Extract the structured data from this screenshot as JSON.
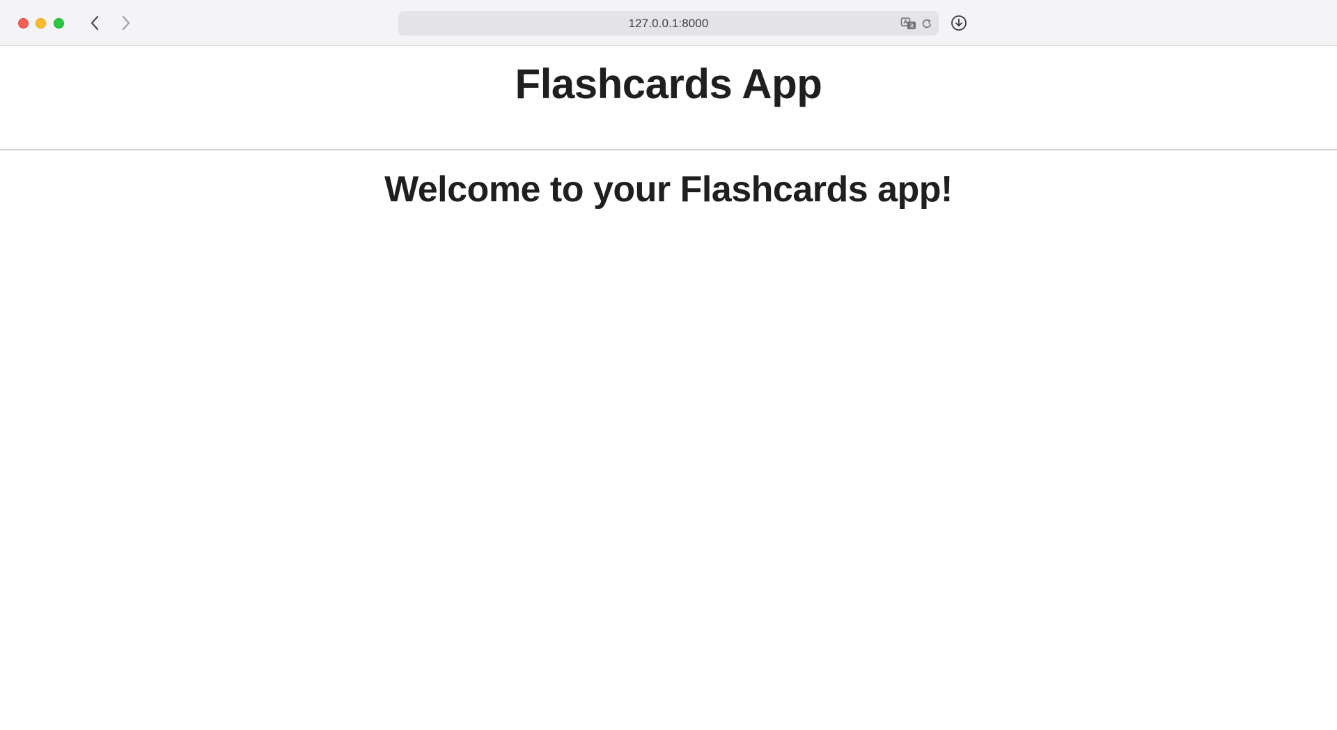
{
  "browser": {
    "address": "127.0.0.1:8000",
    "controls": {
      "close_color": "#fe5f57",
      "minimize_color": "#febc2e",
      "maximize_color": "#28c840"
    },
    "icons": {
      "back": "chevron-left-icon",
      "forward": "chevron-right-icon",
      "translate": "translate-icon",
      "reload": "reload-icon",
      "download": "download-icon"
    }
  },
  "page": {
    "header_title": "Flashcards App",
    "welcome_heading": "Welcome to your Flashcards app!"
  }
}
